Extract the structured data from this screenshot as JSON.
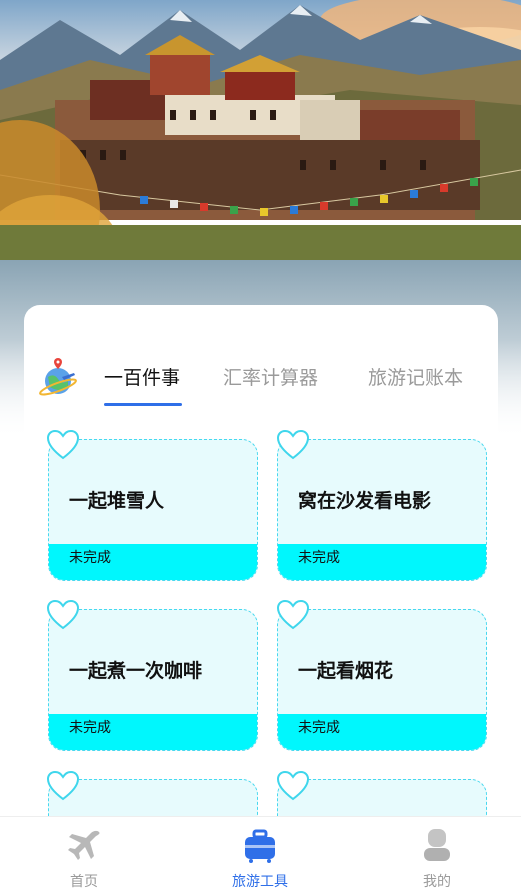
{
  "tabs": [
    {
      "label": "一百件事",
      "active": true
    },
    {
      "label": "汇率计算器",
      "active": false
    },
    {
      "label": "旅游记账本",
      "active": false
    }
  ],
  "cards": [
    {
      "title": "一起堆雪人",
      "status": "未完成"
    },
    {
      "title": "窝在沙发看电影",
      "status": "未完成"
    },
    {
      "title": "一起煮一次咖啡",
      "status": "未完成"
    },
    {
      "title": "一起看烟花",
      "status": "未完成"
    },
    {
      "title": "",
      "status": ""
    },
    {
      "title": "",
      "status": ""
    }
  ],
  "nav": [
    {
      "label": "首页",
      "icon": "airplane-icon",
      "active": false
    },
    {
      "label": "旅游工具",
      "icon": "suitcase-icon",
      "active": true
    },
    {
      "label": "我的",
      "icon": "user-icon",
      "active": false
    }
  ],
  "colors": {
    "accent": "#2f6fe8",
    "card_bg": "#e7fbfd",
    "card_border": "#47d8ef",
    "status_bar": "#00f7fd",
    "inactive": "#9a9a9a"
  }
}
